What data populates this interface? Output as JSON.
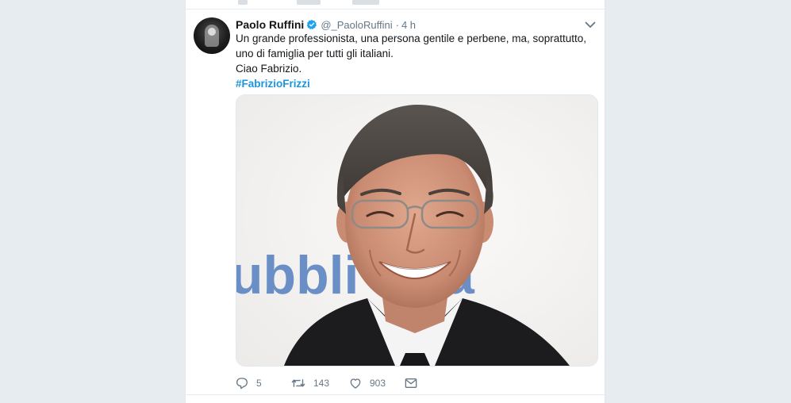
{
  "tweet": {
    "author_name": "Paolo Ruffini",
    "handle": "@_PaoloRuffini",
    "separator": "·",
    "time": "4 h",
    "lines": [
      "Un grande professionista, una persona gentile e perbene, ma, soprattutto, uno di famiglia per tutti gli italiani.",
      "Ciao Fabrizio."
    ],
    "hashtag": "#FabrizioFrizzi",
    "media_caption_text": "ubbli",
    "media_caption_text_2": "a"
  },
  "actions": {
    "reply_count": "5",
    "retweet_count": "143",
    "like_count": "903"
  },
  "colors": {
    "accent": "#1b95e0",
    "text": "#14171a",
    "muted": "#657786",
    "background": "#e6ecf0",
    "backdrop_text": "#6a8fc6"
  },
  "icons": [
    "verified-icon",
    "caret-down-icon",
    "reply-icon",
    "retweet-icon",
    "like-icon",
    "message-icon"
  ]
}
